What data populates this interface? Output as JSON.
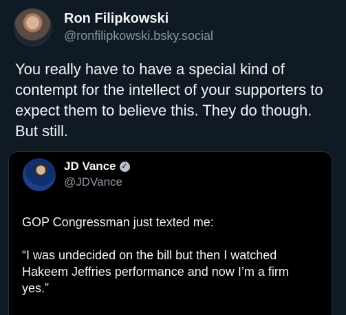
{
  "post": {
    "author": {
      "display_name": "Ron Filipkowski",
      "handle": "@ronfilipkowski.bsky.social"
    },
    "text": "You really have to have a special kind of contempt for the intellect of your supporters to expect them to believe this. They do though. But still."
  },
  "quoted_post": {
    "author": {
      "display_name": "JD Vance",
      "handle": "@JDVance",
      "verified_icon": "✓"
    },
    "paragraphs": [
      "GOP Congressman just texted me:",
      "“I was undecided on the bill but then I watched Hakeem Jeffries performance and now I’m a firm yes.”"
    ]
  }
}
